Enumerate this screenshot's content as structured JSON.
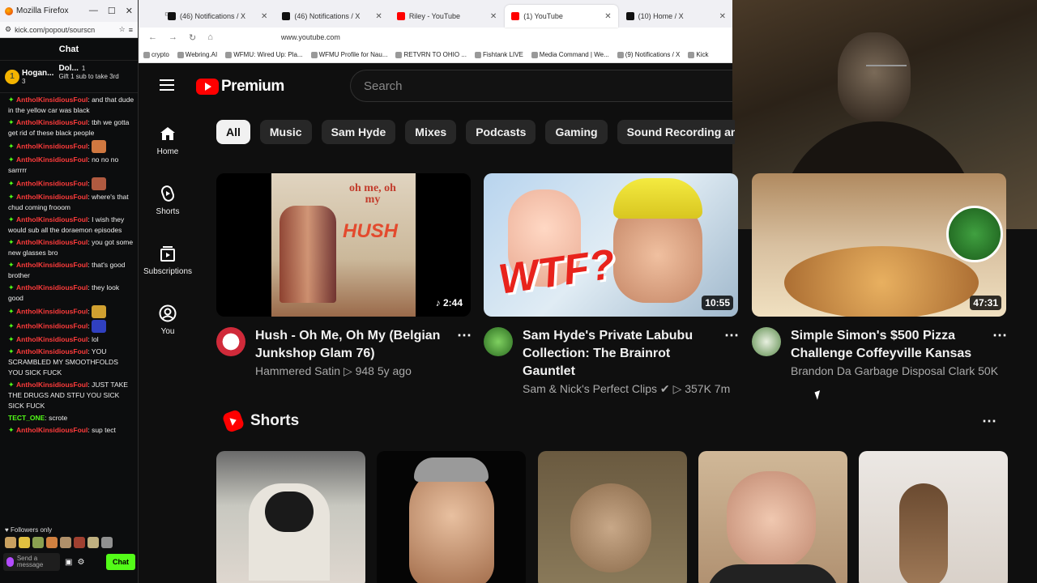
{
  "firefox_popup": {
    "title": "Mozilla Firefox",
    "url": "kick.com/popout/sourscn",
    "chat_header": "Chat",
    "pinned": [
      {
        "name": "Hogan...",
        "count": "3"
      },
      {
        "name": "Dol...",
        "count": "1",
        "gift_text": "Gift 1 sub to take 3rd"
      }
    ],
    "messages": [
      {
        "user": "AntholKinsidiousFoul",
        "text": "and that dude in the yellow car was black"
      },
      {
        "user": "AntholKinsidiousFoul",
        "text": "tbh we gotta get rid of these black people"
      },
      {
        "user": "AntholKinsidiousFoul",
        "text": ""
      },
      {
        "user": "AntholKinsidiousFoul",
        "text": "no no no sarrrrr"
      },
      {
        "user": "AntholKinsidiousFoul",
        "text": ""
      },
      {
        "user": "AntholKinsidiousFoul",
        "text": "where's that chud coming frooom"
      },
      {
        "user": "AntholKinsidiousFoul",
        "text": "I wish they would sub all the doraemon episodes"
      },
      {
        "user": "AntholKinsidiousFoul",
        "text": "you got some new glasses bro"
      },
      {
        "user": "AntholKinsidiousFoul",
        "text": "that's good brother"
      },
      {
        "user": "AntholKinsidiousFoul",
        "text": "they look good"
      },
      {
        "user": "AntholKinsidiousFoul",
        "text": ""
      },
      {
        "user": "AntholKinsidiousFoul",
        "text": ""
      },
      {
        "user": "AntholKinsidiousFoul",
        "text": "lol"
      },
      {
        "user": "AntholKinsidiousFoul",
        "text": "YOU SCRAMBLED MY SMOOTHFOLDS YOU SICK FUCK"
      },
      {
        "user": "AntholKinsidiousFoul",
        "text": "JUST TAKE THE DRUGS AND STFU YOU SICK SICK FUCK"
      },
      {
        "user": "TECT_ONE",
        "text": "scrote",
        "green": true
      },
      {
        "user": "AntholKinsidiousFoul",
        "text": "sup tect"
      }
    ],
    "followers_only": "Followers only",
    "send_placeholder": "Send a message",
    "chat_button": "Chat"
  },
  "browser": {
    "tabs": [
      {
        "label": "(46) Notifications / X",
        "fav": "#111"
      },
      {
        "label": "(46) Notifications / X",
        "fav": "#111"
      },
      {
        "label": "Riley - YouTube",
        "fav": "#ff0000"
      },
      {
        "label": "(1) YouTube",
        "fav": "#ff0000",
        "active": true
      },
      {
        "label": "(10) Home / X",
        "fav": "#111"
      }
    ],
    "url": "www.youtube.com",
    "bookmarks": [
      "crypto",
      "Webring.AI",
      "WFMU: Wired Up: Pla...",
      "WFMU Profile for Nau...",
      "RETVRN TO OHIO ...",
      "Fishtank LIVE",
      "Media Command | We...",
      "(9) Notifications / X",
      "Kick"
    ]
  },
  "youtube": {
    "logo_text": "Premium",
    "search_placeholder": "Search",
    "guide": [
      {
        "label": "Home",
        "icon": "home-icon"
      },
      {
        "label": "Shorts",
        "icon": "shorts-icon"
      },
      {
        "label": "Subscriptions",
        "icon": "subscriptions-icon"
      },
      {
        "label": "You",
        "icon": "you-icon"
      }
    ],
    "chips": [
      "All",
      "Music",
      "Sam Hyde",
      "Mixes",
      "Podcasts",
      "Gaming",
      "Sound Recording and R"
    ],
    "videos": [
      {
        "title": "Hush - Oh Me, Oh My (Belgian Junkshop Glam 76)",
        "channel": "Hammered Satin",
        "stats": "▷ 948  5y ago",
        "duration": "♪ 2:44"
      },
      {
        "title": "Sam Hyde's Private Labubu Collection: The Brainrot Gauntlet",
        "channel": "Sam & Nick's Perfect Clips ✔",
        "stats": "▷ 357K  7m...",
        "duration": "10:55"
      },
      {
        "title": "Simple Simon's $500 Pizza Challenge Coffeyville Kansas",
        "channel": "Brandon Da Garbage Disposal Clark",
        "stats": "50K",
        "duration": "47:31"
      }
    ],
    "shorts_title": "Shorts",
    "thumb_text": {
      "v1_title": "oh me, oh my",
      "v1_label": "HUSH",
      "v2_text": "WTF?"
    }
  }
}
